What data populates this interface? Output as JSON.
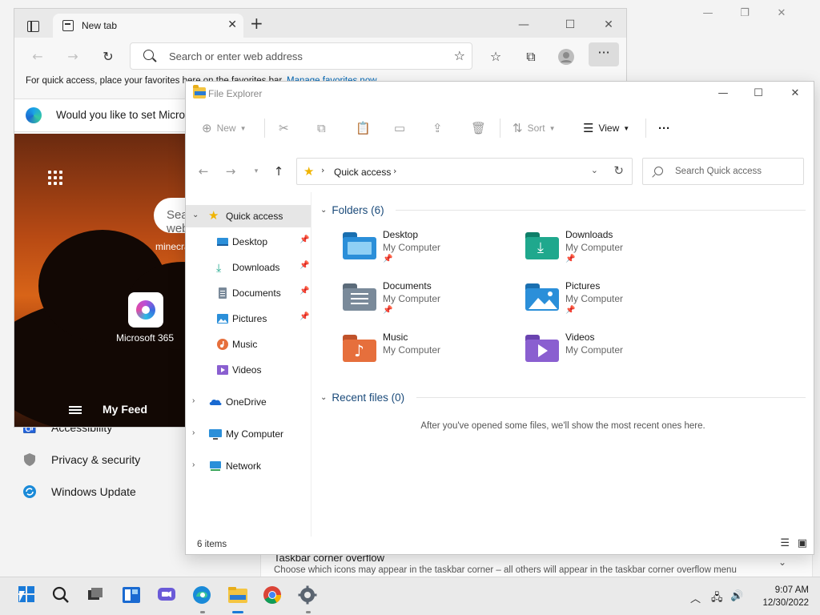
{
  "settings": {
    "items": [
      {
        "label": "Accessibility"
      },
      {
        "label": "Privacy & security"
      },
      {
        "label": "Windows Update"
      }
    ],
    "corner_overflow": {
      "title": "Taskbar corner overflow",
      "subtitle": "Choose which icons may appear in the taskbar corner – all others will appear in the taskbar corner overflow menu"
    }
  },
  "edge": {
    "tab_title": "New tab",
    "address_placeholder": "Search or enter web address",
    "favbar_text": "For quick access, place your favorites here on the favorites bar.",
    "favbar_link": "Manage favorites now",
    "infobar_text": "Would you like to set Microsoft Edge as your default browser?",
    "search_placeholder": "Search the web",
    "search_hint": "minecraft",
    "m365_label": "Microsoft 365",
    "feed_label": "My Feed"
  },
  "explorer": {
    "title": "File Explorer",
    "commands": {
      "new": "New",
      "sort": "Sort",
      "view": "View"
    },
    "breadcrumb": "Quick access",
    "search_placeholder": "Search Quick access",
    "sidebar": [
      {
        "label": "Quick access"
      },
      {
        "label": "Desktop"
      },
      {
        "label": "Downloads"
      },
      {
        "label": "Documents"
      },
      {
        "label": "Pictures"
      },
      {
        "label": "Music"
      },
      {
        "label": "Videos"
      },
      {
        "label": "OneDrive"
      },
      {
        "label": "My Computer"
      },
      {
        "label": "Network"
      }
    ],
    "folders_header": "Folders (6)",
    "folders": [
      {
        "name": "Desktop",
        "location": "My Computer"
      },
      {
        "name": "Downloads",
        "location": "My Computer"
      },
      {
        "name": "Documents",
        "location": "My Computer"
      },
      {
        "name": "Pictures",
        "location": "My Computer"
      },
      {
        "name": "Music",
        "location": "My Computer"
      },
      {
        "name": "Videos",
        "location": "My Computer"
      }
    ],
    "recent_header": "Recent files (0)",
    "empty_message": "After you've opened some files, we'll show the most recent ones here.",
    "status": "6 items"
  },
  "taskbar": {
    "time": "9:07 AM",
    "date": "12/30/2022"
  },
  "colors": {
    "accent": "#0067c0",
    "folder_blue": "#2b8fd9",
    "folder_teal": "#1fa88d",
    "folder_gray": "#7a8a9a",
    "folder_orange": "#e66f3c",
    "folder_purple": "#8a5fd0"
  }
}
